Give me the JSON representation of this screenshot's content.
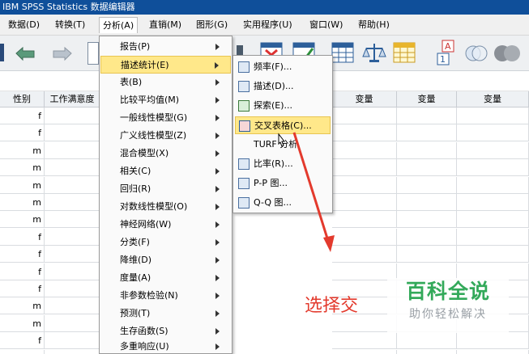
{
  "window": {
    "title": "IBM SPSS Statistics 数据编辑器"
  },
  "menubar": [
    {
      "label": "数据(D)"
    },
    {
      "label": "转换(T)"
    },
    {
      "label": "分析(A)"
    },
    {
      "label": "直销(M)"
    },
    {
      "label": "图形(G)"
    },
    {
      "label": "实用程序(U)"
    },
    {
      "label": "窗口(W)"
    },
    {
      "label": "帮助(H)"
    }
  ],
  "grid": {
    "columns": [
      "性别",
      "工作满意度",
      "变量",
      "变量",
      "变量"
    ],
    "rows": [
      "f",
      "f",
      "m",
      "m",
      "m",
      "m",
      "m",
      "f",
      "f",
      "f",
      "f",
      "m",
      "m",
      "f",
      "f"
    ]
  },
  "analyze_menu": {
    "items": [
      {
        "label": "报告(P)"
      },
      {
        "label": "描述统计(E)"
      },
      {
        "label": "表(B)"
      },
      {
        "label": "比较平均值(M)"
      },
      {
        "label": "一般线性模型(G)"
      },
      {
        "label": "广义线性模型(Z)"
      },
      {
        "label": "混合模型(X)"
      },
      {
        "label": "相关(C)"
      },
      {
        "label": "回归(R)"
      },
      {
        "label": "对数线性模型(O)"
      },
      {
        "label": "神经网络(W)"
      },
      {
        "label": "分类(F)"
      },
      {
        "label": "降维(D)"
      },
      {
        "label": "度量(A)"
      },
      {
        "label": "非参数检验(N)"
      },
      {
        "label": "预测(T)"
      },
      {
        "label": "生存函数(S)"
      },
      {
        "label": "多重响应(U)"
      }
    ]
  },
  "descriptive_submenu": {
    "items": [
      {
        "label": "频率(F)...",
        "icon": "frequencies-icon"
      },
      {
        "label": "描述(D)...",
        "icon": "descriptives-icon"
      },
      {
        "label": "探索(E)...",
        "icon": "explore-icon"
      },
      {
        "label": "交叉表格(C)...",
        "icon": "crosstabs-icon"
      },
      {
        "label": "TURF 分析",
        "icon": ""
      },
      {
        "label": "比率(R)...",
        "icon": "ratio-icon"
      },
      {
        "label": "P-P 图...",
        "icon": "pp-plot-icon"
      },
      {
        "label": "Q-Q 图...",
        "icon": "qq-plot-icon"
      }
    ]
  },
  "annotation": {
    "text": "选择交"
  },
  "watermark": {
    "main": "百科全说",
    "sub": "助你轻松解决"
  },
  "colors": {
    "title_bar": "#0f4f9a",
    "highlight": "#ffe88a",
    "callout_text": "#e33a2d",
    "arrow": "#e33a2d",
    "watermark_green": "#33a95a"
  }
}
